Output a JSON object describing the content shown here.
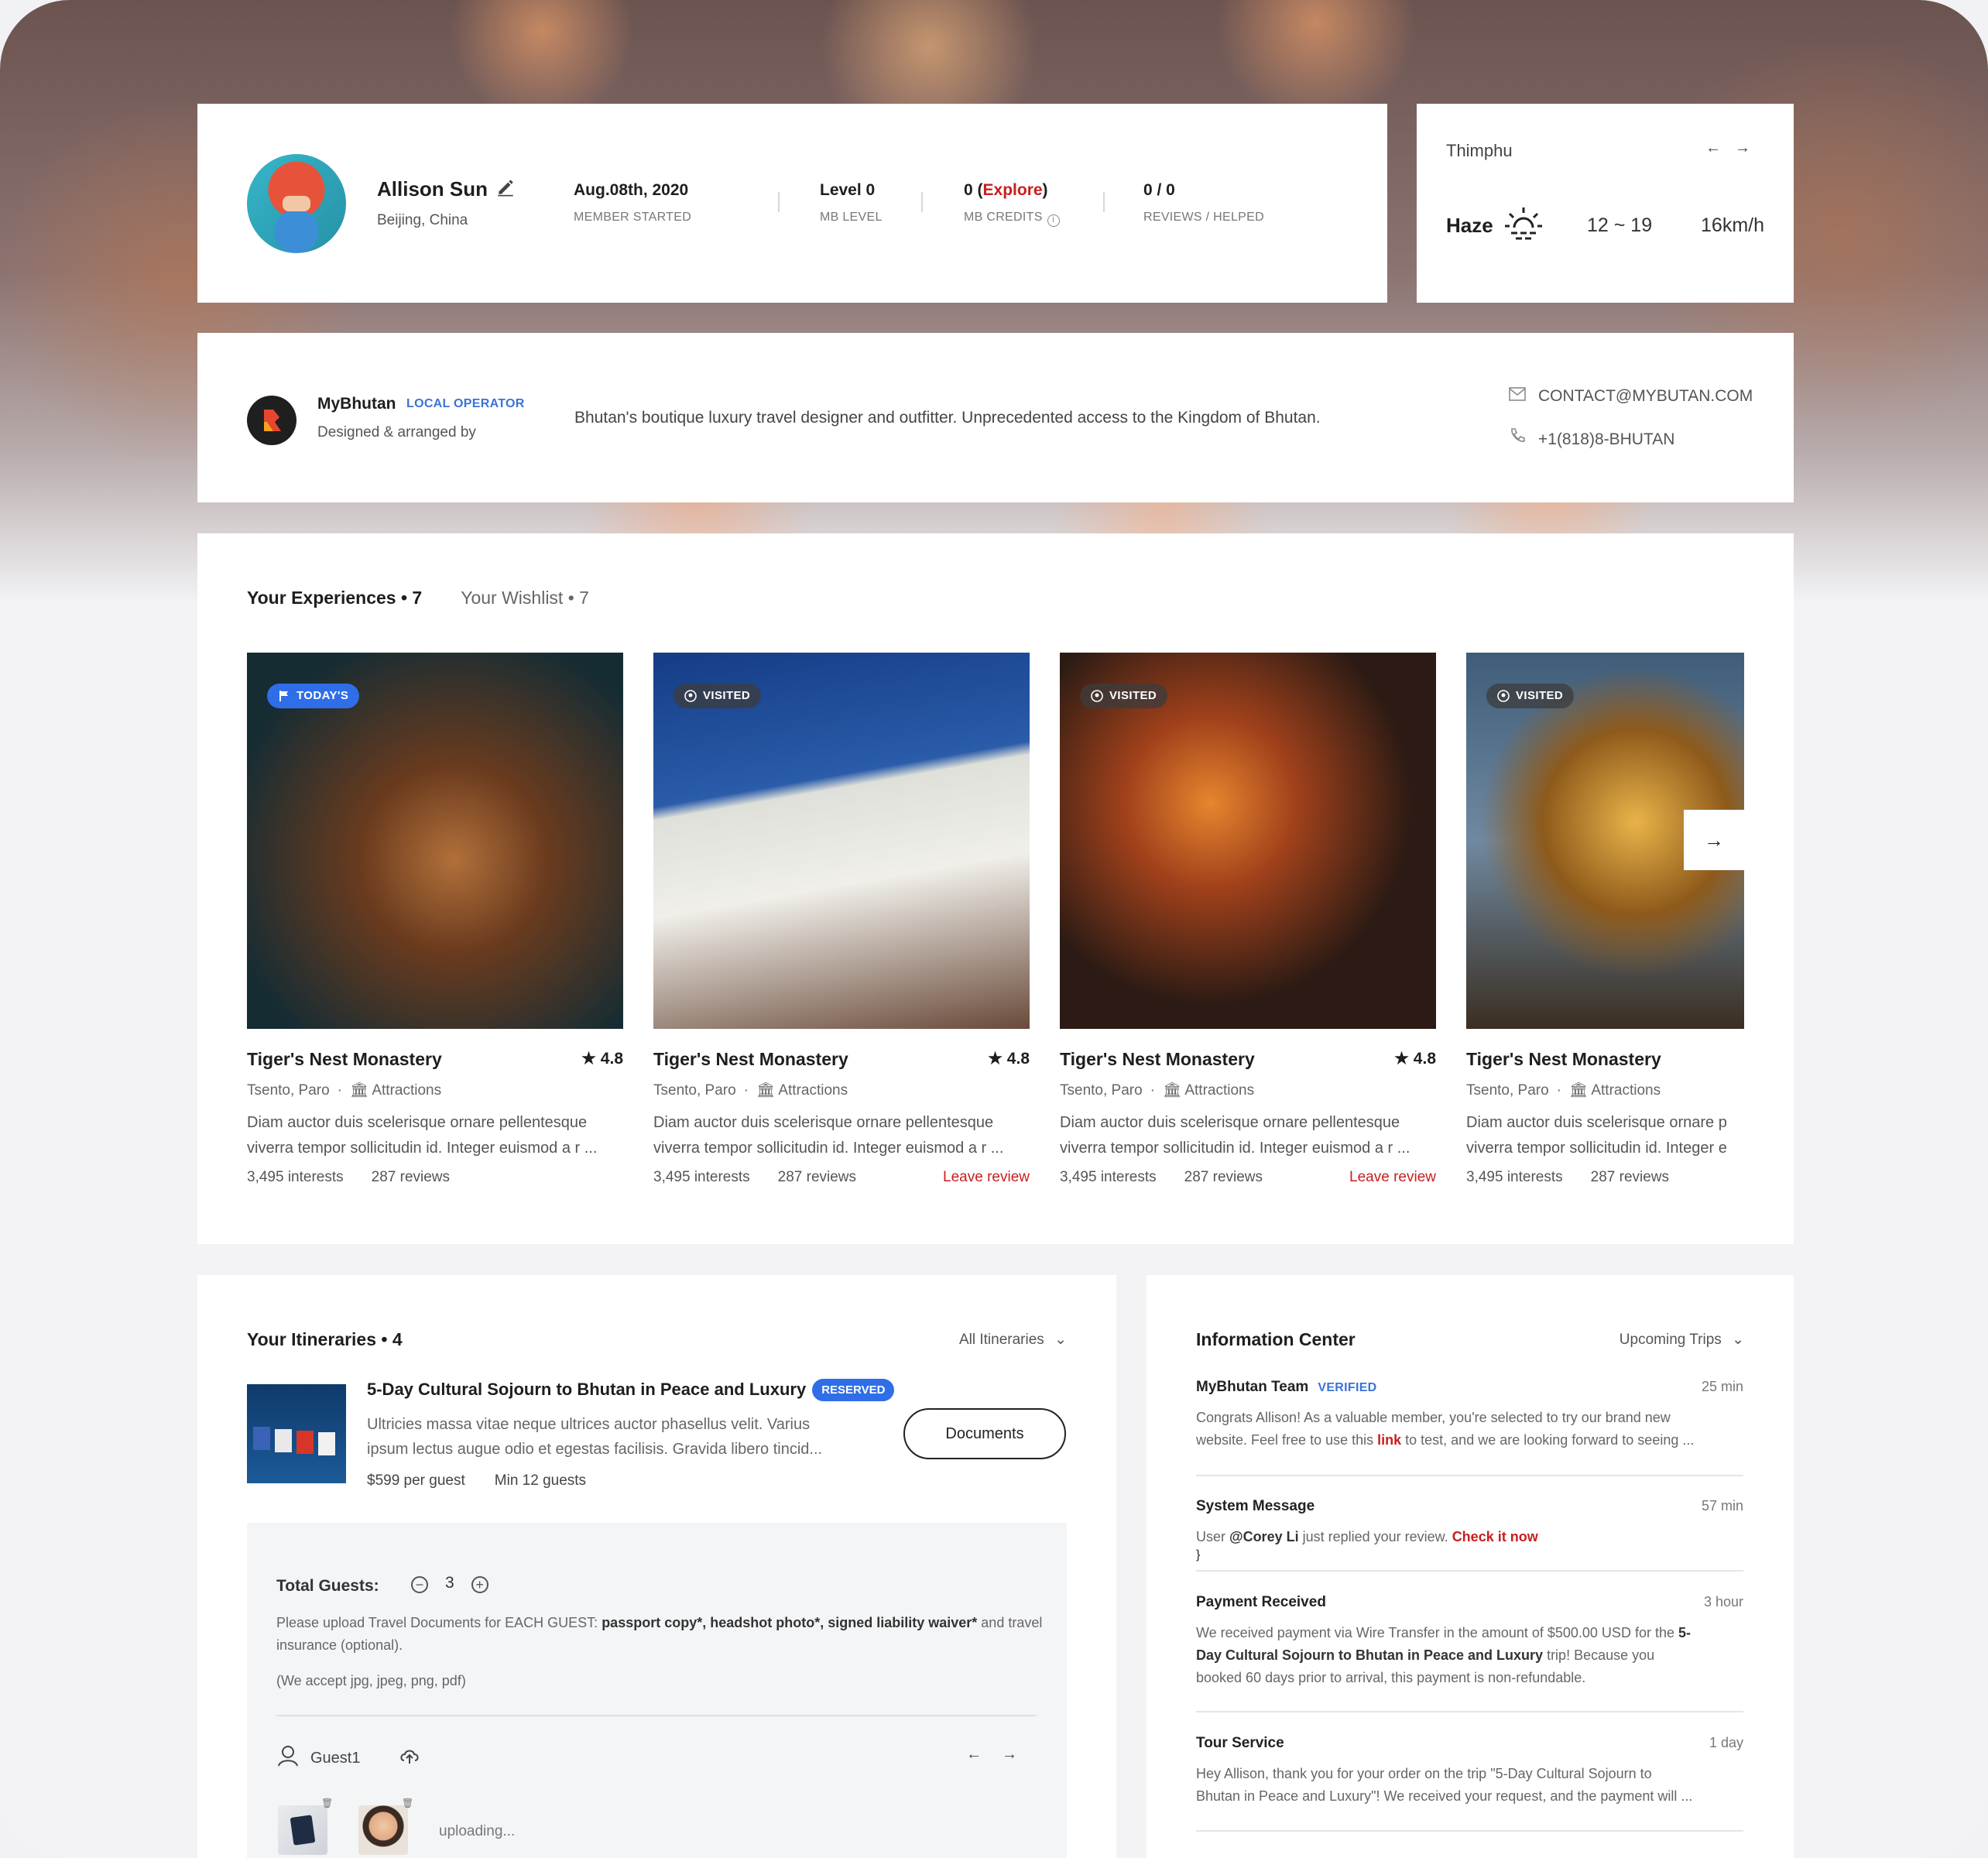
{
  "profile": {
    "name": "Allison Sun",
    "location": "Beijing, China",
    "member_started_value": "Aug.08th, 2020",
    "member_started_label": "MEMBER STARTED",
    "level_value": "Level 0",
    "level_label": "MB LEVEL",
    "credits_value": "0",
    "credits_link": "Explore",
    "credits_label": "MB CREDITS",
    "reviews_value": "0 / 0",
    "reviews_label": "REVIEWS / HELPED"
  },
  "weather": {
    "city": "Thimphu",
    "condition": "Haze",
    "temp_range": "12 ~ 19",
    "wind": "16km/h",
    "prev_arrow": "←",
    "next_arrow": "→"
  },
  "operator": {
    "name": "MyBhutan",
    "tag": "LOCAL OPERATOR",
    "subtitle": "Designed & arranged by",
    "description": "Bhutan's boutique luxury travel designer and outfitter. Unprecedented access to the Kingdom of Bhutan.",
    "email": "CONTACT@MYBUTAN.COM",
    "phone": "+1(818)8-BHUTAN"
  },
  "experiences": {
    "tab_active": "Your Experiences • 7",
    "tab_other": "Your Wishlist • 7",
    "cards": [
      {
        "badge": "TODAY'S",
        "title": "Tiger's Nest Monastery",
        "rating": "★ 4.8",
        "location": "Tsento, Paro",
        "category": "Attractions",
        "desc_line1": "Diam auctor duis scelerisque ornare pellentesque",
        "desc_line2": "viverra tempor sollicitudin id. Integer euismod a r ...",
        "interests": "3,495 interests",
        "reviews": "287 reviews",
        "action": ""
      },
      {
        "badge": "VISITED",
        "title": "Tiger's Nest Monastery",
        "rating": "★ 4.8",
        "location": "Tsento, Paro",
        "category": "Attractions",
        "desc_line1": "Diam auctor duis scelerisque ornare pellentesque",
        "desc_line2": "viverra tempor sollicitudin id. Integer euismod a r ...",
        "interests": "3,495 interests",
        "reviews": "287 reviews",
        "action": "Leave review"
      },
      {
        "badge": "VISITED",
        "title": "Tiger's Nest Monastery",
        "rating": "★ 4.8",
        "location": "Tsento, Paro",
        "category": "Attractions",
        "desc_line1": "Diam auctor duis scelerisque ornare pellentesque",
        "desc_line2": "viverra tempor sollicitudin id. Integer euismod a r ...",
        "interests": "3,495 interests",
        "reviews": "287 reviews",
        "action": "Leave review"
      },
      {
        "badge": "VISITED",
        "title": "Tiger's Nest Monastery",
        "rating": "",
        "location": "Tsento, Paro",
        "category": "Attractions",
        "desc_line1": "Diam auctor duis scelerisque ornare p",
        "desc_line2": "viverra tempor sollicitudin id. Integer e",
        "interests": "3,495 interests",
        "reviews": "287 reviews",
        "action": ""
      }
    ],
    "next_arrow": "→"
  },
  "itineraries": {
    "title": "Your Itineraries • 4",
    "filter": "All Itineraries",
    "item": {
      "title": "5-Day Cultural Sojourn to Bhutan in Peace and Luxury",
      "status": "RESERVED",
      "desc_line1": "Ultricies massa vitae neque ultrices auctor phasellus velit. Varius",
      "desc_line2": "ipsum lectus augue odio et egestas facilisis. Gravida libero tincid...",
      "price": "$599 per guest",
      "min_guests": "Min 12 guests",
      "documents_button": "Documents"
    },
    "guests": {
      "label": "Total Guests:",
      "count": "3",
      "minus": "−",
      "plus": "+",
      "note_prefix": "Please upload Travel Documents for EACH GUEST: ",
      "note_required": "passport copy*, headshot photo*, signed liability waiver*",
      "note_suffix": " and travel insurance (optional).",
      "accept": "(We accept jpg, jpeg, png, pdf)",
      "guest_name": "Guest1",
      "uploading": "uploading...",
      "prev_arrow": "←",
      "next_arrow": "→"
    }
  },
  "info_center": {
    "title": "Information Center",
    "filter": "Upcoming Trips",
    "messages": [
      {
        "sender": "MyBhutan Team",
        "tag": "VERIFIED",
        "time": "25 min",
        "line1": "Congrats Allison! As a valuable member, you're selected to try our brand new",
        "line2_a": "website. Feel free to use this ",
        "line2_link": "link",
        "line2_b": " to test, and we are looking forward to seeing ..."
      },
      {
        "sender": "System Message",
        "time": "57 min",
        "line1_a": "User ",
        "line1_user": "@Corey Li",
        "line1_b": " just replied your review. ",
        "line1_link": "Check it now"
      },
      {
        "sender": "Payment Received",
        "time": "3 hour",
        "line1_a": "We received payment via Wire Transfer in the amount of $500.00 USD for the ",
        "line1_b": "5-",
        "line2_b": "Day Cultural Sojourn to Bhutan in Peace and Luxury",
        "line2_a": " trip!  Because you",
        "line3": "booked 60 days prior to arrival, this payment is non-refundable."
      },
      {
        "sender": "Tour Service",
        "time": "1 day",
        "line1": "Hey Allison, thank you for your order on the trip \"5-Day Cultural Sojourn to",
        "line2": "Bhutan in Peace and Luxury\"! We received your request, and the payment will ..."
      }
    ]
  },
  "colors": {
    "accent_blue": "#2f6ee8",
    "accent_red": "#c81e1e"
  }
}
